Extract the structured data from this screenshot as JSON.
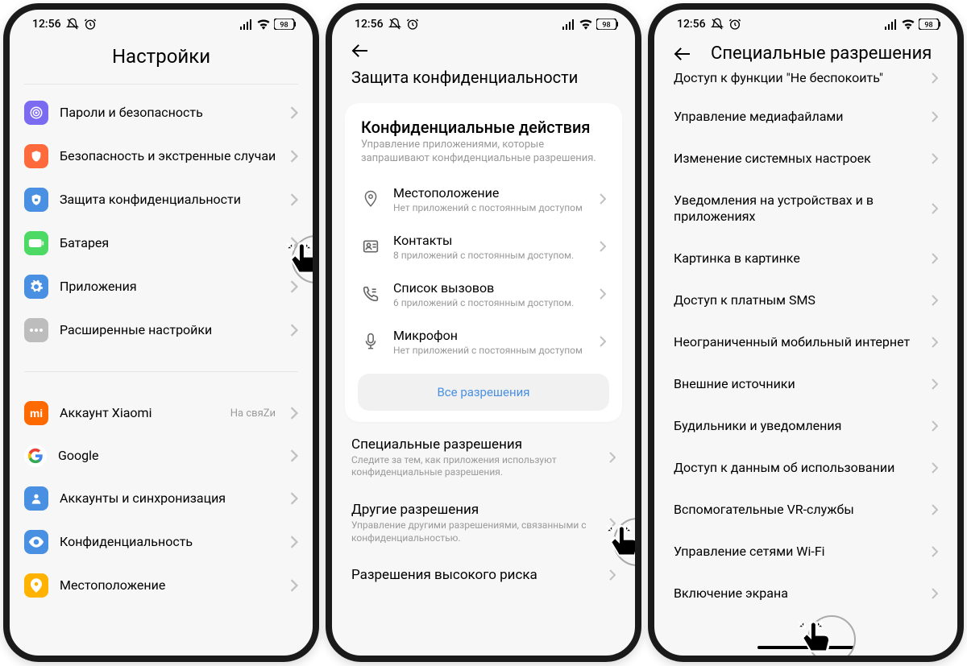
{
  "status": {
    "time": "12:56",
    "battery": "98"
  },
  "screen1": {
    "title": "Настройки",
    "group1": [
      {
        "label": "Пароли и безопасность",
        "color": "#7b6bf0",
        "icon": "target"
      },
      {
        "label": "Безопасность и экстренные случаи",
        "color": "#ff6a3d",
        "icon": "shield"
      },
      {
        "label": "Защита конфиденциальности",
        "color": "#4a90e2",
        "icon": "lock"
      },
      {
        "label": "Батарея",
        "color": "#4cd964",
        "icon": "battery"
      },
      {
        "label": "Приложения",
        "color": "#4a90e2",
        "icon": "gear"
      },
      {
        "label": "Расширенные настройки",
        "color": "#bdbdbd",
        "icon": "dots"
      }
    ],
    "group2": [
      {
        "label": "Аккаунт Xiaomi",
        "color": "#ff6a00",
        "icon": "mi",
        "sub": "На свяZи"
      },
      {
        "label": "Google",
        "icon": "google"
      },
      {
        "label": "Аккаунты и синхронизация",
        "color": "#4a90e2",
        "icon": "user"
      },
      {
        "label": "Конфиденциальность",
        "color": "#4a90e2",
        "icon": "eye"
      },
      {
        "label": "Местоположение",
        "color": "#ffb300",
        "icon": "pin"
      }
    ]
  },
  "screen2": {
    "title": "Защита конфиденциальности",
    "card_title": "Конфиденциальные действия",
    "card_desc": "Управление приложениями, которые запрашивают конфиденциальные разрешения.",
    "perms": [
      {
        "title": "Местоположение",
        "desc": "Нет приложений с постоянным доступом",
        "icon": "pin"
      },
      {
        "title": "Контакты",
        "desc": "8 приложений с постоянным доступом.",
        "icon": "contacts"
      },
      {
        "title": "Список вызовов",
        "desc": "6 приложений с постоянным доступом.",
        "icon": "phone"
      },
      {
        "title": "Микрофон",
        "desc": "Нет приложений с постоянным доступом",
        "icon": "mic"
      }
    ],
    "all_perms": "Все разрешения",
    "rows": [
      {
        "title": "Специальные разрешения",
        "desc": "Следите за тем, как приложения используют конфиденциальные разрешения."
      },
      {
        "title": "Другие разрешения",
        "desc": "Управление другими разрешениями, связанными с конфиденциальностью."
      },
      {
        "title": "Разрешения высокого риска",
        "desc": ""
      }
    ]
  },
  "screen3": {
    "title": "Специальные разрешения",
    "items": [
      "Доступ к функции \"Не беспокоить\"",
      "Управление медиафайлами",
      "Изменение системных настроек",
      "Уведомления на устройствах и в приложениях",
      "Картинка в картинке",
      "Доступ к платным SMS",
      "Неограниченный мобильный интернет",
      "Внешние источники",
      "Будильники и уведомления",
      "Доступ к данным об использовании",
      "Вспомогательные VR-службы",
      "Управление сетями Wi-Fi",
      "Включение экрана"
    ]
  }
}
